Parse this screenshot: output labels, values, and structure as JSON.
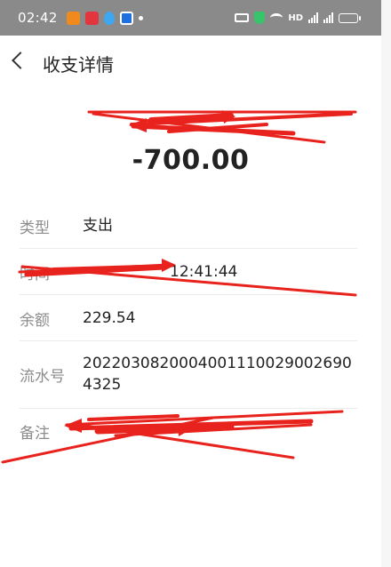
{
  "status_bar": {
    "time": "02:42",
    "network_label": "HD",
    "icons": [
      "taobao-icon",
      "app-red-icon",
      "blue-drop-icon",
      "blue-app-icon",
      "notification-dot-icon",
      "vibrate-icon",
      "shield-icon",
      "wifi-icon",
      "signal-icon",
      "battery-icon"
    ]
  },
  "header": {
    "title": "收支详情"
  },
  "summary": {
    "amount": "-700.00"
  },
  "details": [
    {
      "label": "类型",
      "value": "支出"
    },
    {
      "label": "时间",
      "value": "12:41:44"
    },
    {
      "label": "余额",
      "value": "229.54"
    },
    {
      "label": "流水号",
      "value": "20220308200040011100290026904325"
    },
    {
      "label": "备注",
      "value": ""
    }
  ],
  "colors": {
    "redaction": "#e8221c",
    "status_bar": "#8a8a8a"
  }
}
